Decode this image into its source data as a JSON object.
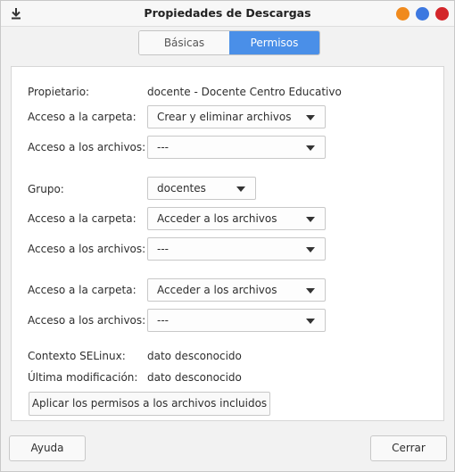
{
  "window": {
    "title": "Propiedades de Descargas",
    "controls": [
      "minimize",
      "maximize",
      "close"
    ],
    "control_colors": {
      "minimize": "#f08a1d",
      "maximize": "#3d78e0",
      "close": "#d3262a"
    }
  },
  "tabs": [
    {
      "label": "Básicas",
      "selected": false
    },
    {
      "label": "Permisos",
      "selected": true
    }
  ],
  "accent_color": "#4a8fe8",
  "owner": {
    "label": "Propietario:",
    "value": "docente - Docente Centro Educativo",
    "folder_access_label": "Acceso a la carpeta:",
    "folder_access_value": "Crear y eliminar archivos",
    "file_access_label": "Acceso a los archivos:",
    "file_access_value": "---"
  },
  "group": {
    "label": "Grupo:",
    "value": "docentes",
    "folder_access_label": "Acceso a la carpeta:",
    "folder_access_value": "Acceder a los archivos",
    "file_access_label": "Acceso a los archivos:",
    "file_access_value": "---"
  },
  "others": {
    "folder_access_label": "Acceso a la carpeta:",
    "folder_access_value": "Acceder a los archivos",
    "file_access_label": "Acceso a los archivos:",
    "file_access_value": "---"
  },
  "selinux": {
    "label": "Contexto SELinux:",
    "value": "dato desconocido"
  },
  "modified": {
    "label": "Última modificación:",
    "value": "dato desconocido"
  },
  "apply_button": "Aplicar los permisos a los archivos incluidos",
  "footer": {
    "help": "Ayuda",
    "close": "Cerrar"
  }
}
